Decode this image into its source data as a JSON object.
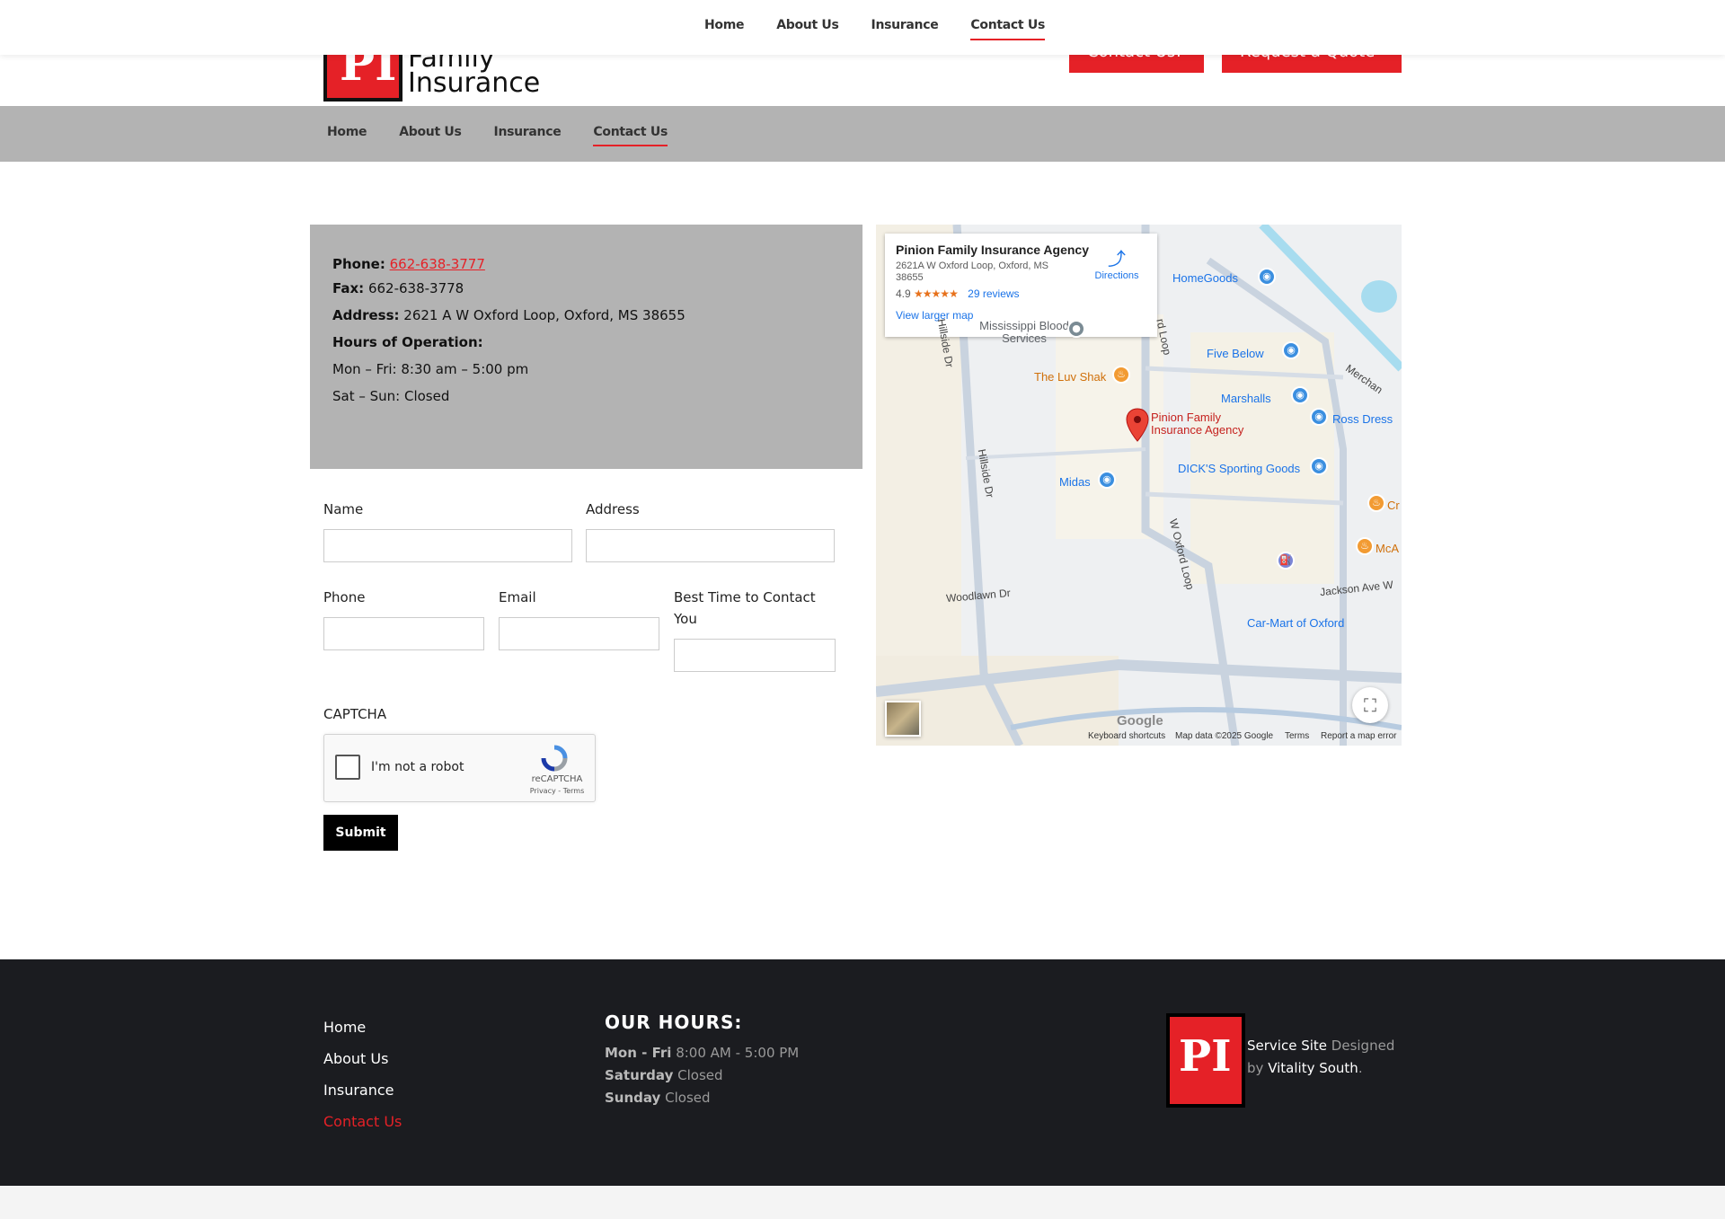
{
  "nav": {
    "items": [
      {
        "label": "Home",
        "active": false
      },
      {
        "label": "About Us",
        "active": false
      },
      {
        "label": "Insurance",
        "active": false
      },
      {
        "label": "Contact Us",
        "active": true
      }
    ]
  },
  "header": {
    "logo_monogram": "PI",
    "logo_line1": "Family",
    "logo_line2": "Insurance",
    "btn_contact": "Contact Us!",
    "btn_quote": "Request a Quote"
  },
  "info": {
    "phone_label": "Phone:",
    "phone_value": "662-638-3777",
    "fax_label": "Fax:",
    "fax_value": "662-638-3778",
    "address_label": "Address:",
    "address_value": "2621 A W Oxford Loop, Oxford, MS 38655",
    "hours_label": "Hours of Operation:",
    "hours_weekday": "Mon – Fri: 8:30 am – 5:00 pm",
    "hours_weekend": "Sat – Sun: Closed"
  },
  "form": {
    "name_label": "Name",
    "address_label": "Address",
    "phone_label": "Phone",
    "email_label": "Email",
    "best_time_label": "Best Time to Contact You",
    "captcha_label": "CAPTCHA",
    "captcha_text": "I'm not a robot",
    "captcha_brand": "reCAPTCHA",
    "captcha_links": "Privacy - Terms",
    "submit_label": "Submit"
  },
  "map": {
    "card_title": "Pinion Family Insurance Agency",
    "card_address": "2621A W Oxford Loop, Oxford, MS 38655",
    "card_rating": "4.9",
    "card_stars": "★★★★★",
    "card_reviews": "29 reviews",
    "card_larger": "View larger map",
    "card_directions": "Directions",
    "labels": {
      "homegoods": "HomeGoods",
      "mississippi_blood": "Mississippi Blood Services",
      "five_below": "Five Below",
      "luv_shak": "The Luv Shak",
      "marshalls": "Marshalls",
      "ross": "Ross Dress",
      "pinion": "Pinion Family Insurance Agency",
      "dicks": "DICK'S Sporting Goods",
      "midas": "Midas",
      "cr": "Cr",
      "mca": "McA",
      "car_mart": "Car-Mart of Oxford",
      "merchant": "Merchan",
      "hillside1": "Hillside Dr",
      "hillside2": "Hillside Dr",
      "woxford": "W Oxford Loop",
      "woodlawn": "Woodlawn Dr",
      "jackson": "Jackson Ave W",
      "oxfordloop_top": "rd Loop"
    },
    "google": "Google",
    "attr_keyboard": "Keyboard shortcuts",
    "attr_data": "Map data ©2025 Google",
    "attr_terms": "Terms",
    "attr_report": "Report a map error"
  },
  "footer": {
    "links": [
      {
        "label": "Home",
        "active": false
      },
      {
        "label": "About Us",
        "active": false
      },
      {
        "label": "Insurance",
        "active": false
      },
      {
        "label": "Contact Us",
        "active": true
      }
    ],
    "hours_title": "OUR HOURS:",
    "hours": [
      {
        "day": "Mon - Fri",
        "time": "8:00 AM - 5:00 PM"
      },
      {
        "day": "Saturday",
        "time": "Closed"
      },
      {
        "day": "Sunday",
        "time": "Closed"
      }
    ],
    "credit_service": "Service Site",
    "credit_designed": "Designed by",
    "credit_company": "Vitality South",
    "credit_period": "."
  },
  "colors": {
    "accent": "#e52127",
    "gray_band": "#b3b3b3",
    "footer_bg": "#1b1c20"
  }
}
